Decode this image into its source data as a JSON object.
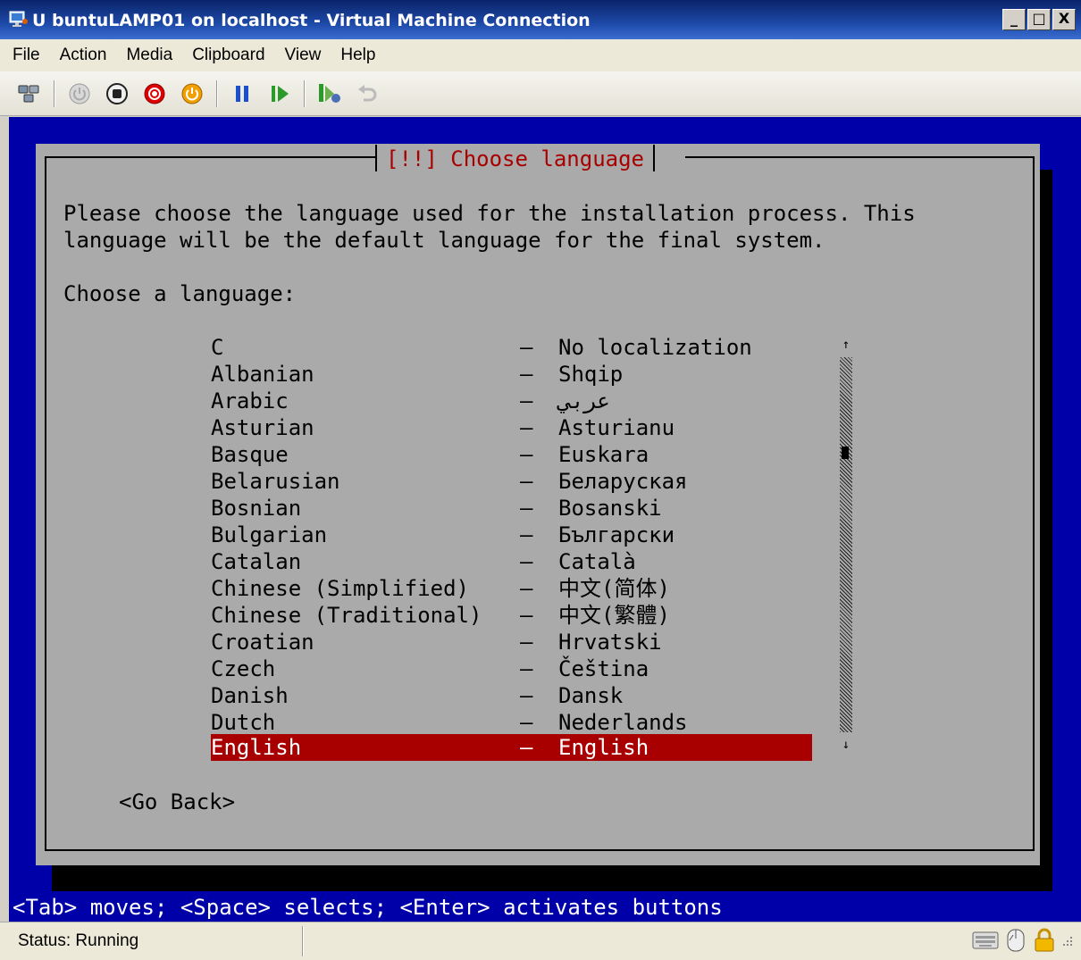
{
  "window": {
    "title": "U buntuLAMP01 on localhost - Virtual Machine Connection",
    "buttons": {
      "minimize": "_",
      "maximize": "□",
      "close": "X"
    }
  },
  "menu": [
    "File",
    "Action",
    "Media",
    "Clipboard",
    "View",
    "Help"
  ],
  "toolbar": {
    "icons": [
      "ctrl-alt-del-icon",
      "start-icon",
      "turn-off-icon",
      "shutdown-icon",
      "power-icon",
      "pause-icon",
      "resume-icon",
      "snapshot-icon",
      "revert-icon"
    ]
  },
  "installer": {
    "dialog_title": "[!!] Choose language",
    "description_line1": "Please choose the language used for the installation process. This",
    "description_line2": "language will be the default language for the final system.",
    "prompt": "Choose a language:",
    "languages": [
      {
        "name": "C",
        "native": "No localization"
      },
      {
        "name": "Albanian",
        "native": "Shqip"
      },
      {
        "name": "Arabic",
        "native": "عربي"
      },
      {
        "name": "Asturian",
        "native": "Asturianu"
      },
      {
        "name": "Basque",
        "native": "Euskara"
      },
      {
        "name": "Belarusian",
        "native": "Беларуская"
      },
      {
        "name": "Bosnian",
        "native": "Bosanski"
      },
      {
        "name": "Bulgarian",
        "native": "Български"
      },
      {
        "name": "Catalan",
        "native": "Català"
      },
      {
        "name": "Chinese (Simplified)",
        "native": "中文(简体)"
      },
      {
        "name": "Chinese (Traditional)",
        "native": "中文(繁體)"
      },
      {
        "name": "Croatian",
        "native": "Hrvatski"
      },
      {
        "name": "Czech",
        "native": "Čeština"
      },
      {
        "name": "Danish",
        "native": "Dansk"
      },
      {
        "name": "Dutch",
        "native": "Nederlands"
      },
      {
        "name": "English",
        "native": "English"
      }
    ],
    "dash": "–",
    "selected_language": "English",
    "go_back": "<Go Back>",
    "hint": "<Tab> moves; <Space> selects; <Enter> activates buttons",
    "scroll_up": "↑",
    "scroll_down": "↓"
  },
  "status": {
    "text": "Status: Running"
  }
}
